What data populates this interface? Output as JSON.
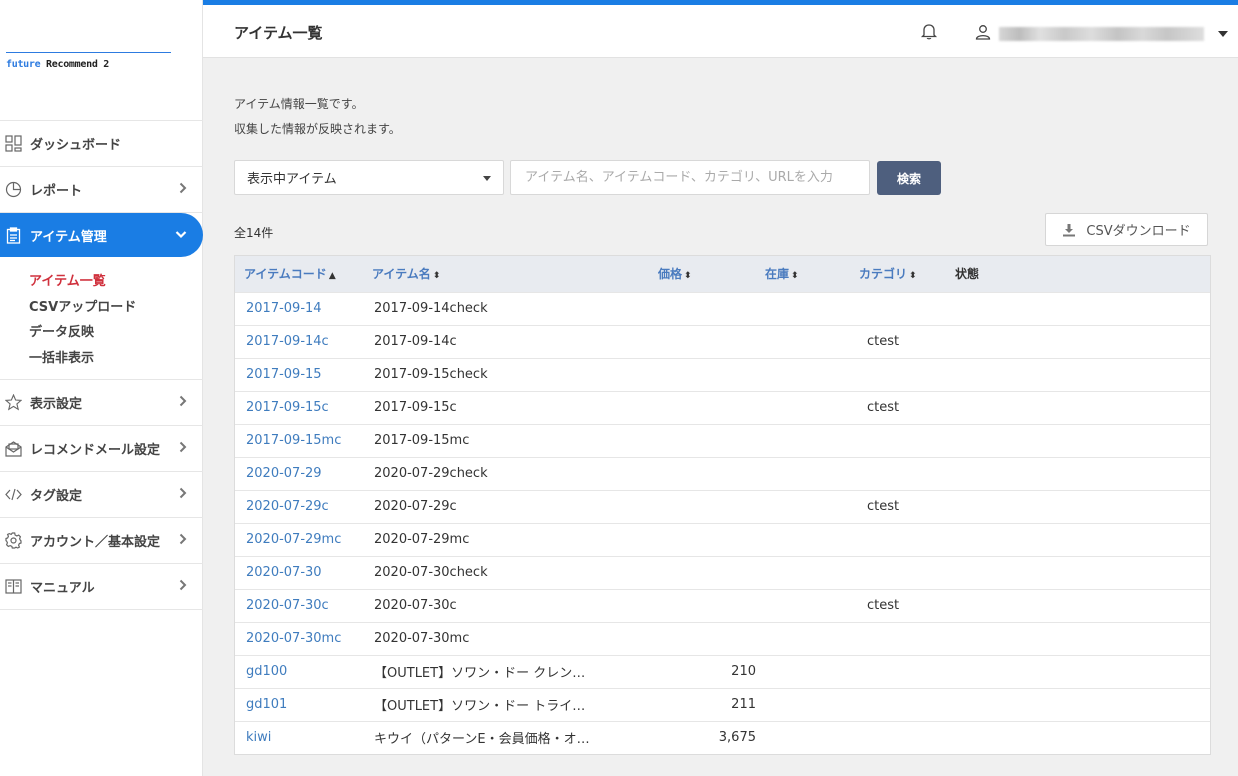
{
  "logo": {
    "accent": "future",
    "rest": " Recommend 2"
  },
  "sidebar": {
    "items": [
      {
        "label": "ダッシュボード",
        "icon": "dashboard-icon"
      },
      {
        "label": "レポート",
        "icon": "pie-chart-icon"
      },
      {
        "label": "アイテム管理",
        "icon": "clipboard-icon"
      },
      {
        "label": "表示設定",
        "icon": "star-icon"
      },
      {
        "label": "レコメンドメール設定",
        "icon": "mail-icon"
      },
      {
        "label": "タグ設定",
        "icon": "code-icon"
      },
      {
        "label": "アカウント／基本設定",
        "icon": "gear-icon"
      },
      {
        "label": "マニュアル",
        "icon": "book-icon"
      }
    ],
    "subitems": [
      "アイテム一覧",
      "CSVアップロード",
      "データ反映",
      "一括非表示"
    ]
  },
  "header": {
    "title": "アイテム一覧"
  },
  "main": {
    "desc_line1": "アイテム情報一覧です。",
    "desc_line2": "収集した情報が反映されます。",
    "filter_select": "表示中アイテム",
    "search_placeholder": "アイテム名、アイテムコード、カテゴリ、URLを入力",
    "search_button": "検索",
    "total": "全14件",
    "csv_button": "CSVダウンロード"
  },
  "table": {
    "headers": [
      "アイテムコード",
      "アイテム名",
      "価格",
      "在庫",
      "カテゴリ",
      "状態"
    ],
    "rows": [
      [
        "2017-09-14",
        "2017-09-14check",
        "",
        "",
        "",
        ""
      ],
      [
        "2017-09-14c",
        "2017-09-14c",
        "",
        "",
        "ctest",
        ""
      ],
      [
        "2017-09-15",
        "2017-09-15check",
        "",
        "",
        "",
        ""
      ],
      [
        "2017-09-15c",
        "2017-09-15c",
        "",
        "",
        "ctest",
        ""
      ],
      [
        "2017-09-15mc",
        "2017-09-15mc",
        "",
        "",
        "",
        ""
      ],
      [
        "2020-07-29",
        "2020-07-29check",
        "",
        "",
        "",
        ""
      ],
      [
        "2020-07-29c",
        "2020-07-29c",
        "",
        "",
        "ctest",
        ""
      ],
      [
        "2020-07-29mc",
        "2020-07-29mc",
        "",
        "",
        "",
        ""
      ],
      [
        "2020-07-30",
        "2020-07-30check",
        "",
        "",
        "",
        ""
      ],
      [
        "2020-07-30c",
        "2020-07-30c",
        "",
        "",
        "ctest",
        ""
      ],
      [
        "2020-07-30mc",
        "2020-07-30mc",
        "",
        "",
        "",
        ""
      ],
      [
        "gd100",
        "【OUTLET】ソワン・ドー クレン…",
        "210",
        "",
        "",
        ""
      ],
      [
        "gd101",
        "【OUTLET】ソワン・ドー トライ…",
        "211",
        "",
        "",
        ""
      ],
      [
        "kiwi",
        "キウイ（パターンE・会員価格・オ…",
        "3,675",
        "",
        "",
        ""
      ]
    ]
  },
  "colors": {
    "accent": "#1a7de4",
    "link": "#3f7cbe",
    "current_sub": "#d0313d",
    "search_button": "#4e5f7e"
  }
}
